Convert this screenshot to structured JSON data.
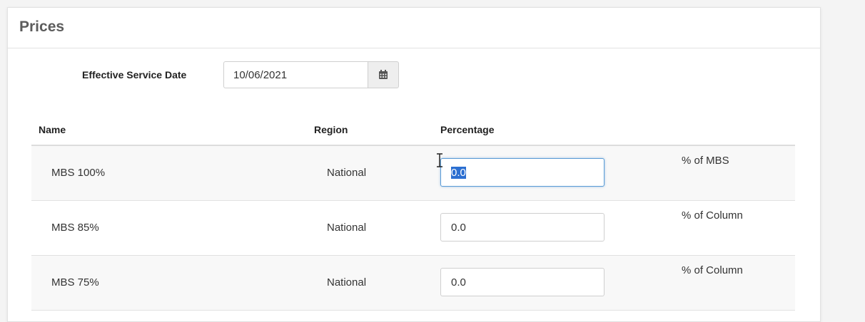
{
  "panel": {
    "title": "Prices"
  },
  "effective_date": {
    "label": "Effective Service Date",
    "value": "10/06/2021",
    "calendar_icon": "calendar-icon"
  },
  "table": {
    "headers": {
      "name": "Name",
      "region": "Region",
      "percentage": "Percentage"
    },
    "rows": [
      {
        "name": "MBS 100%",
        "region": "National",
        "percentage": "0.0",
        "unit": "% of MBS"
      },
      {
        "name": "MBS 85%",
        "region": "National",
        "percentage": "0.0",
        "unit": "% of Column"
      },
      {
        "name": "MBS 75%",
        "region": "National",
        "percentage": "0.0",
        "unit": "% of Column"
      }
    ]
  },
  "colors": {
    "focus_border": "#5a9bd6",
    "selection": "#2c6fd1"
  }
}
